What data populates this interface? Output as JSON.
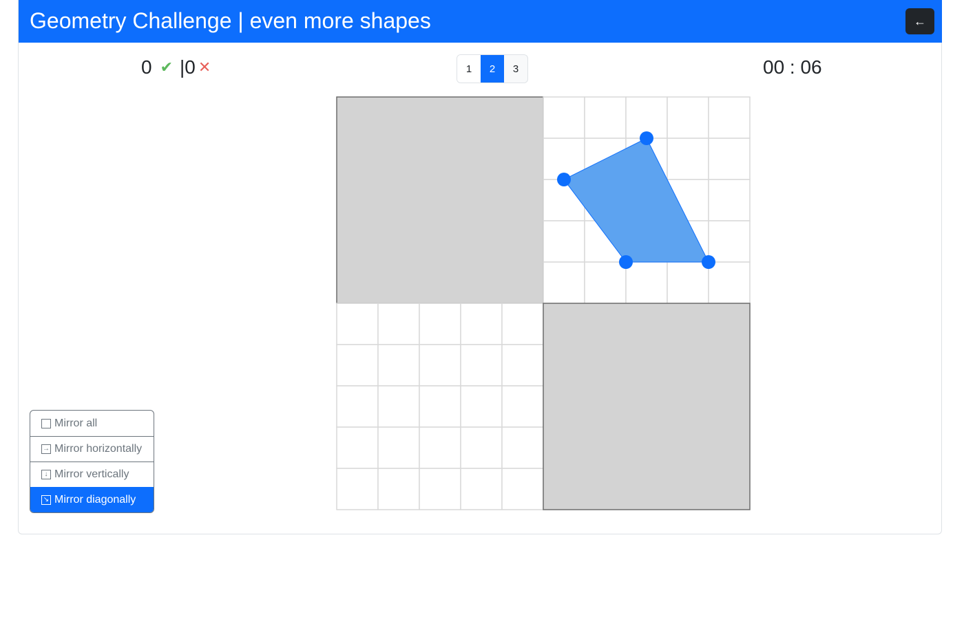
{
  "header": {
    "title": "Geometry Challenge | even more shapes",
    "back_label": "←"
  },
  "score": {
    "correct": "0",
    "separator": "|",
    "wrong": "0"
  },
  "pager": {
    "pages": [
      "1",
      "2",
      "3"
    ],
    "active_index": 1
  },
  "timer": {
    "value": "00 : 06"
  },
  "board": {
    "grid_cells_per_quadrant": 5,
    "shaded_quadrants": [
      "top-left",
      "bottom-right"
    ],
    "shape_quadrant": "top-right",
    "shape_vertices": [
      [
        2.5,
        1
      ],
      [
        0.5,
        2
      ],
      [
        2,
        4
      ],
      [
        4,
        4
      ]
    ],
    "colors": {
      "shaded": "#d3d3d3",
      "grid": "#d9d9d9",
      "shape_fill": "#5da3f0",
      "vertex": "#0d6efd"
    }
  },
  "mirror": {
    "items": [
      {
        "label": "Mirror all",
        "icon": ""
      },
      {
        "label": "Mirror horizontally",
        "icon": "→"
      },
      {
        "label": "Mirror vertically",
        "icon": "↓"
      },
      {
        "label": "Mirror diagonally",
        "icon": "↘"
      }
    ],
    "active_index": 3
  },
  "colors": {
    "accent": "#0d6efd",
    "correct": "#5cb85c",
    "wrong": "#e8605a"
  }
}
